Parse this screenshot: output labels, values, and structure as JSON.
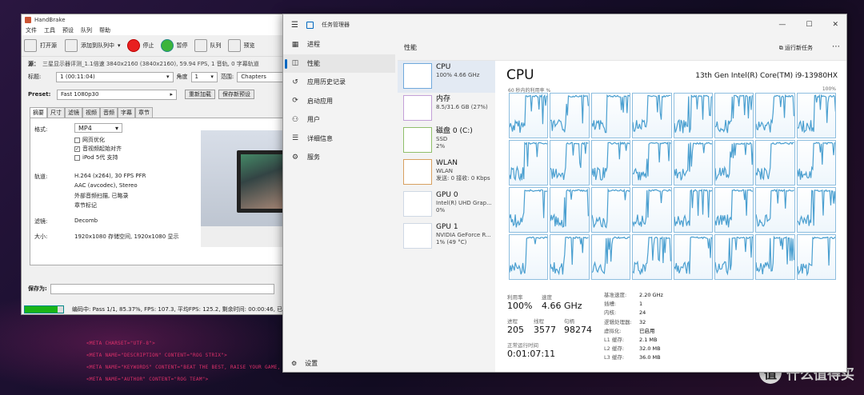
{
  "desktop": {
    "code_lines": [
      "<META CHARSET=\"UTF-8\">",
      "<META NAME=\"DESCRIPTION\" CONTENT=\"ROG STRIX\">",
      "<META NAME=\"KEYWORDS\" CONTENT=\"BEAT THE BEST, RAISE YOUR GAME, GAMERS, ST",
      "<META NAME=\"AUTHOR\" CONTENT=\"ROG TEAM\">"
    ],
    "watermark": "什么值得买",
    "watermark_logo": "值"
  },
  "handbrake": {
    "title": "HandBrake",
    "menu": [
      "文件",
      "工具",
      "预设",
      "队列",
      "帮助"
    ],
    "toolbar": {
      "open": "打开源",
      "add_queue": "添加到队列中",
      "stop": "停止",
      "pause": "暂停",
      "queue": "队列",
      "preview": "预览"
    },
    "source_label": "源：",
    "source_value": "三星显示器评测_1.1倍速  3840x2160 (3840x2160), 59.94 FPS, 1 音轨, 0 字幕轨道",
    "title_label": "标题:",
    "title_value": "1 (00:11:04)",
    "angle_label": "角度",
    "angle_value": "1",
    "range_label": "范围:",
    "range_value": "Chapters",
    "preset_label": "Preset:",
    "preset_value": "Fast 1080p30",
    "reload_btn": "重新加载",
    "save_preset_btn": "保存新预设",
    "tabs": [
      "摘要",
      "尺寸",
      "滤镜",
      "视频",
      "音频",
      "字幕",
      "章节"
    ],
    "format_label": "格式:",
    "format_value": "MP4",
    "web_opt": "网页优化",
    "align_av": "音视频起始对齐",
    "ipod": "iPod 5代 支持",
    "tracks_label": "轨道:",
    "tracks": [
      "H.264 (x264), 30 FPS PFR",
      "AAC (avcodec), Stereo",
      "外部音频扫描, 已略录",
      "章节标记"
    ],
    "filters_label": "滤镜:",
    "filters_value": "Decomb",
    "size_label": "大小:",
    "size_value": "1920x1080 存储空间, 1920x1080 显示",
    "save_as_label": "保存为:",
    "status": "编码中: Pass 1/1, 85.37%, FPS: 107.3, 平均FPS: 125.2, 剩余时间: 00:00:46, 已",
    "progress": 0.8537
  },
  "taskmgr": {
    "title": "任务管理器",
    "nav": [
      "进程",
      "性能",
      "应用历史记录",
      "启动应用",
      "用户",
      "详细信息",
      "服务"
    ],
    "nav_icons": [
      "grid-icon",
      "performance-icon",
      "history-icon",
      "startup-icon",
      "users-icon",
      "details-icon",
      "services-icon"
    ],
    "nav_glyphs": [
      "▦",
      "◫",
      "↺",
      "⟳",
      "⚇",
      "☰",
      "⚙"
    ],
    "settings": "设置",
    "header": "性能",
    "run_task": "运行新任务",
    "side": [
      {
        "name": "CPU",
        "l1": "100% 4.66 GHz",
        "l2": ""
      },
      {
        "name": "内存",
        "l1": "8.5/31.6 GB (27%)",
        "l2": ""
      },
      {
        "name": "磁盘 0 (C:)",
        "l1": "SSD",
        "l2": "2%"
      },
      {
        "name": "WLAN",
        "l1": "WLAN",
        "l2": "发送: 0 接收: 0 Kbps"
      },
      {
        "name": "GPU 0",
        "l1": "Intel(R) UHD Grap...",
        "l2": "0%"
      },
      {
        "name": "GPU 1",
        "l1": "NVIDIA GeForce R...",
        "l2": "1% (49 °C)"
      }
    ],
    "cpu_title": "CPU",
    "cpu_model": "13th Gen Intel(R) Core(TM) i9-13980HX",
    "util_label": "60 秒内的利用率 %",
    "util_max": "100%",
    "stats": {
      "util_k": "利用率",
      "util_v": "100%",
      "speed_k": "速度",
      "speed_v": "4.66 GHz",
      "proc_k": "进程",
      "proc_v": "205",
      "threads_k": "线程",
      "threads_v": "3577",
      "handles_k": "句柄",
      "handles_v": "98274",
      "uptime_k": "正常运行时间",
      "uptime_v": "0:01:07:11"
    },
    "spec": [
      {
        "k": "基准速度:",
        "v": "2.20 GHz"
      },
      {
        "k": "插槽:",
        "v": "1"
      },
      {
        "k": "内核:",
        "v": "24"
      },
      {
        "k": "逻辑处理器:",
        "v": "32"
      },
      {
        "k": "虚拟化:",
        "v": "已启用"
      },
      {
        "k": "L1 缓存:",
        "v": "2.1 MB"
      },
      {
        "k": "L2 缓存:",
        "v": "32.0 MB"
      },
      {
        "k": "L3 缓存:",
        "v": "36.0 MB"
      }
    ],
    "accent": "#0067c0",
    "graph_color": "#4a9fd0"
  }
}
